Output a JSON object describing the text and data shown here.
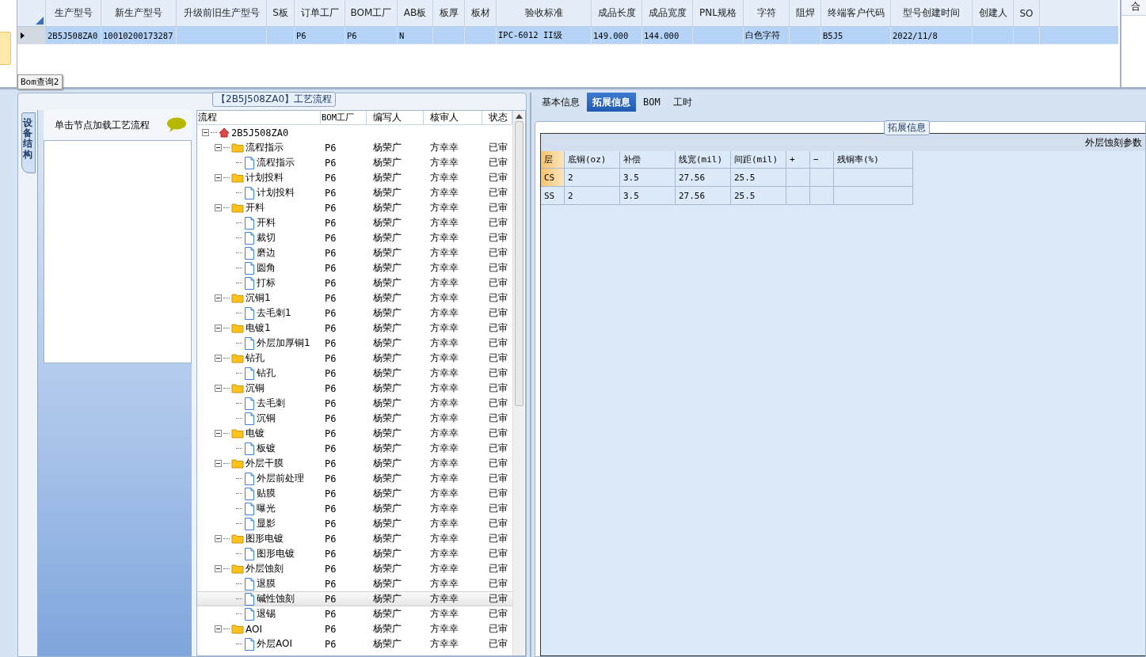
{
  "top_grid": {
    "columns": [
      "生产型号",
      "新生产型号",
      "升级前旧生产型号",
      "S板",
      "订单工厂",
      "BOM工厂",
      "AB板",
      "板厚",
      "板材",
      "验收标准",
      "成品长度",
      "成品宽度",
      "PNL规格",
      "字符",
      "阻焊",
      "终端客户代码",
      "型号创建时间",
      "创建人",
      "SO"
    ],
    "rows": [
      {
        "selected": true,
        "cells": [
          "2B5J508ZA0",
          "10010200173287",
          "",
          "",
          "P6",
          "P6",
          "N",
          "",
          "",
          "IPC-6012 II级",
          "149.000",
          "144.000",
          "",
          "白色字符",
          "",
          "B5J5",
          "2022/11/8",
          "",
          ""
        ]
      }
    ]
  },
  "side_panel": {
    "column": "合"
  },
  "bottom_tab": "Bom查询2",
  "flow_group": {
    "title": "【2B5J508ZA0】工艺流程",
    "vertical_tab": "设备结构",
    "hint": "单击节点加载工艺流程",
    "tree_columns": [
      "流程",
      "BOM工厂",
      "编写人",
      "核审人",
      "状态"
    ],
    "tree": [
      {
        "kind": "root",
        "label": "2B5J508ZA0",
        "expanded": true,
        "selected": false,
        "children": [
          {
            "kind": "folder",
            "label": "流程指示",
            "cells": [
              "P6",
              "杨荣广",
              "方幸幸",
              "已审"
            ],
            "expanded": true,
            "selected": false,
            "children": [
              {
                "kind": "file",
                "label": "流程指示",
                "cells": [
                  "P6",
                  "杨荣广",
                  "方幸幸",
                  "已审"
                ],
                "selected": false
              }
            ]
          },
          {
            "kind": "folder",
            "label": "计划投料",
            "cells": [
              "P6",
              "杨荣广",
              "方幸幸",
              "已审"
            ],
            "expanded": true,
            "selected": false,
            "children": [
              {
                "kind": "file",
                "label": "计划投料",
                "cells": [
                  "P6",
                  "杨荣广",
                  "方幸幸",
                  "已审"
                ],
                "selected": false
              }
            ]
          },
          {
            "kind": "folder",
            "label": "开料",
            "cells": [
              "P6",
              "杨荣广",
              "方幸幸",
              "已审"
            ],
            "expanded": true,
            "selected": false,
            "children": [
              {
                "kind": "file",
                "label": "开料",
                "cells": [
                  "P6",
                  "杨荣广",
                  "方幸幸",
                  "已审"
                ],
                "selected": false
              },
              {
                "kind": "file",
                "label": "裁切",
                "cells": [
                  "P6",
                  "杨荣广",
                  "方幸幸",
                  "已审"
                ],
                "selected": false
              },
              {
                "kind": "file",
                "label": "磨边",
                "cells": [
                  "P6",
                  "杨荣广",
                  "方幸幸",
                  "已审"
                ],
                "selected": false
              },
              {
                "kind": "file",
                "label": "圆角",
                "cells": [
                  "P6",
                  "杨荣广",
                  "方幸幸",
                  "已审"
                ],
                "selected": false
              },
              {
                "kind": "file",
                "label": "打标",
                "cells": [
                  "P6",
                  "杨荣广",
                  "方幸幸",
                  "已审"
                ],
                "selected": false
              }
            ]
          },
          {
            "kind": "folder",
            "label": "沉铜1",
            "cells": [
              "P6",
              "杨荣广",
              "方幸幸",
              "已审"
            ],
            "expanded": true,
            "selected": false,
            "children": [
              {
                "kind": "file",
                "label": "去毛刺1",
                "cells": [
                  "P6",
                  "杨荣广",
                  "方幸幸",
                  "已审"
                ],
                "selected": false
              }
            ]
          },
          {
            "kind": "folder",
            "label": "电镀1",
            "cells": [
              "P6",
              "杨荣广",
              "方幸幸",
              "已审"
            ],
            "expanded": true,
            "selected": false,
            "children": [
              {
                "kind": "file",
                "label": "外层加厚铜1",
                "cells": [
                  "P6",
                  "杨荣广",
                  "方幸幸",
                  "已审"
                ],
                "selected": false
              }
            ]
          },
          {
            "kind": "folder",
            "label": "钻孔",
            "cells": [
              "P6",
              "杨荣广",
              "方幸幸",
              "已审"
            ],
            "expanded": true,
            "selected": false,
            "children": [
              {
                "kind": "file",
                "label": "钻孔",
                "cells": [
                  "P6",
                  "杨荣广",
                  "方幸幸",
                  "已审"
                ],
                "selected": false
              }
            ]
          },
          {
            "kind": "folder",
            "label": "沉铜",
            "cells": [
              "P6",
              "杨荣广",
              "方幸幸",
              "已审"
            ],
            "expanded": true,
            "selected": false,
            "children": [
              {
                "kind": "file",
                "label": "去毛刺",
                "cells": [
                  "P6",
                  "杨荣广",
                  "方幸幸",
                  "已审"
                ],
                "selected": false
              },
              {
                "kind": "file",
                "label": "沉铜",
                "cells": [
                  "P6",
                  "杨荣广",
                  "方幸幸",
                  "已审"
                ],
                "selected": false
              }
            ]
          },
          {
            "kind": "folder",
            "label": "电镀",
            "cells": [
              "P6",
              "杨荣广",
              "方幸幸",
              "已审"
            ],
            "expanded": true,
            "selected": false,
            "children": [
              {
                "kind": "file",
                "label": "板镀",
                "cells": [
                  "P6",
                  "杨荣广",
                  "方幸幸",
                  "已审"
                ],
                "selected": false
              }
            ]
          },
          {
            "kind": "folder",
            "label": "外层干膜",
            "cells": [
              "P6",
              "杨荣广",
              "方幸幸",
              "已审"
            ],
            "expanded": true,
            "selected": false,
            "children": [
              {
                "kind": "file",
                "label": "外层前处理",
                "cells": [
                  "P6",
                  "杨荣广",
                  "方幸幸",
                  "已审"
                ],
                "selected": false
              },
              {
                "kind": "file",
                "label": "贴膜",
                "cells": [
                  "P6",
                  "杨荣广",
                  "方幸幸",
                  "已审"
                ],
                "selected": false
              },
              {
                "kind": "file",
                "label": "曝光",
                "cells": [
                  "P6",
                  "杨荣广",
                  "方幸幸",
                  "已审"
                ],
                "selected": false
              },
              {
                "kind": "file",
                "label": "显影",
                "cells": [
                  "P6",
                  "杨荣广",
                  "方幸幸",
                  "已审"
                ],
                "selected": false
              }
            ]
          },
          {
            "kind": "folder",
            "label": "图形电镀",
            "cells": [
              "P6",
              "杨荣广",
              "方幸幸",
              "已审"
            ],
            "expanded": true,
            "selected": false,
            "children": [
              {
                "kind": "file",
                "label": "图形电镀",
                "cells": [
                  "P6",
                  "杨荣广",
                  "方幸幸",
                  "已审"
                ],
                "selected": false
              }
            ]
          },
          {
            "kind": "folder",
            "label": "外层蚀刻",
            "cells": [
              "P6",
              "杨荣广",
              "方幸幸",
              "已审"
            ],
            "expanded": true,
            "selected": false,
            "children": [
              {
                "kind": "file",
                "label": "退膜",
                "cells": [
                  "P6",
                  "杨荣广",
                  "方幸幸",
                  "已审"
                ],
                "selected": false
              },
              {
                "kind": "file",
                "label": "碱性蚀刻",
                "cells": [
                  "P6",
                  "杨荣广",
                  "方幸幸",
                  "已审"
                ],
                "selected": true
              },
              {
                "kind": "file",
                "label": "退锡",
                "cells": [
                  "P6",
                  "杨荣广",
                  "方幸幸",
                  "已审"
                ],
                "selected": false
              }
            ]
          },
          {
            "kind": "folder",
            "label": "AOI",
            "cells": [
              "P6",
              "杨荣广",
              "方幸幸",
              "已审"
            ],
            "expanded": true,
            "selected": false,
            "children": [
              {
                "kind": "file",
                "label": "外层AOI",
                "cells": [
                  "P6",
                  "杨荣广",
                  "方幸幸",
                  "已审"
                ],
                "selected": false
              }
            ]
          }
        ]
      }
    ]
  },
  "info_tabs": [
    {
      "label": "基本信息",
      "selected": false
    },
    {
      "label": "拓展信息",
      "selected": true
    },
    {
      "label": "BOM",
      "selected": false
    },
    {
      "label": "工时",
      "selected": false
    }
  ],
  "info_group": {
    "title": "拓展信息",
    "etch_table": {
      "title": "外层蚀刻参数",
      "columns": [
        "层",
        "底铜(oz)",
        "补偿",
        "线宽(mil)",
        "间距(mil)",
        "+",
        "−",
        "残铜率(%)"
      ],
      "rows": [
        {
          "selected": true,
          "cells": [
            "CS",
            "2",
            "3.5",
            "27.56",
            "25.5",
            "",
            "",
            ""
          ]
        },
        {
          "selected": false,
          "cells": [
            "SS",
            "2",
            "3.5",
            "27.56",
            "25.5",
            "",
            "",
            ""
          ]
        }
      ]
    }
  }
}
